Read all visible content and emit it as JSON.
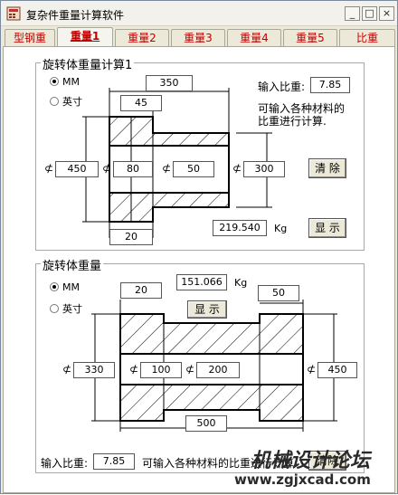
{
  "window": {
    "title": "复杂件重量计算软件",
    "minimize": "_",
    "maximize": "□",
    "close": "×"
  },
  "tabs": [
    "型钢重",
    "重量1",
    "重量2",
    "重量3",
    "重量4",
    "重量5",
    "比重"
  ],
  "group1": {
    "title": "旋转体重量计算1",
    "radio_mm": "MM",
    "radio_inch": "英寸",
    "density_label": "输入比重:",
    "density_value": "7.85",
    "note_line1": "可输入各种材料的",
    "note_line2": "比重进行计算.",
    "dim_top": "350",
    "dim_45": "45",
    "dim_450": "450",
    "dim_80": "80",
    "dim_50": "50",
    "dim_300": "300",
    "dim_20": "20",
    "result": "219.540",
    "unit": "Kg",
    "clear_button": "清  除",
    "show_button": "显  示",
    "phi": "⊄"
  },
  "group2": {
    "title": "旋转体重量",
    "radio_mm": "MM",
    "radio_inch": "英寸",
    "dim_20": "20",
    "result": "151.066",
    "unit": "Kg",
    "dim_50": "50",
    "show_button": "显 示",
    "dim_330": "330",
    "dim_100": "100",
    "dim_200": "200",
    "dim_450": "450",
    "dim_500": "500",
    "density_label": "输入比重:",
    "density_value": "7.85",
    "note": "可输入各种材料的比重进行计算",
    "clear_button": "清除",
    "phi": "⊄"
  },
  "watermark": {
    "line1": "机械设计论坛",
    "line2": "www.zgjxcad.com"
  }
}
